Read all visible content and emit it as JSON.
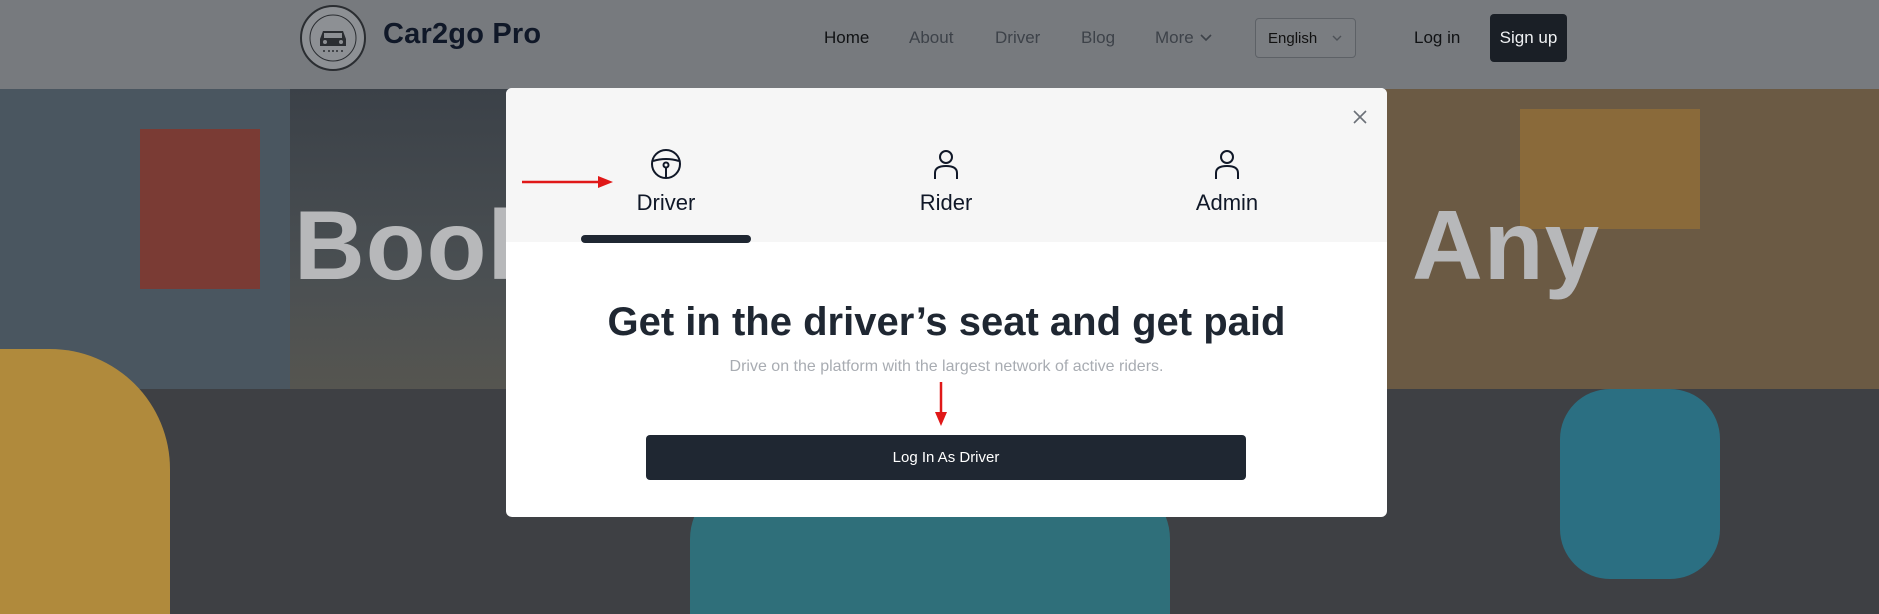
{
  "header": {
    "brand": "Car2go Pro",
    "nav": {
      "home": "Home",
      "about": "About",
      "driver": "Driver",
      "blog": "Blog",
      "more": "More"
    },
    "language": "English",
    "login": "Log in",
    "signup": "Sign up"
  },
  "hero": {
    "title_left": "Book",
    "title_right": "Any"
  },
  "modal": {
    "tabs": [
      {
        "label": "Driver",
        "icon": "steering-wheel-icon",
        "active": true
      },
      {
        "label": "Rider",
        "icon": "person-icon",
        "active": false
      },
      {
        "label": "Admin",
        "icon": "person-icon",
        "active": false
      }
    ],
    "heading": "Get in the driver’s seat and get paid",
    "subtext": "Drive on the platform with the largest network of active riders.",
    "cta": "Log In As Driver"
  },
  "colors": {
    "primary_dark": "#1f2732",
    "annotation_arrow": "#e01818",
    "header_overlay": "#777a7e"
  }
}
